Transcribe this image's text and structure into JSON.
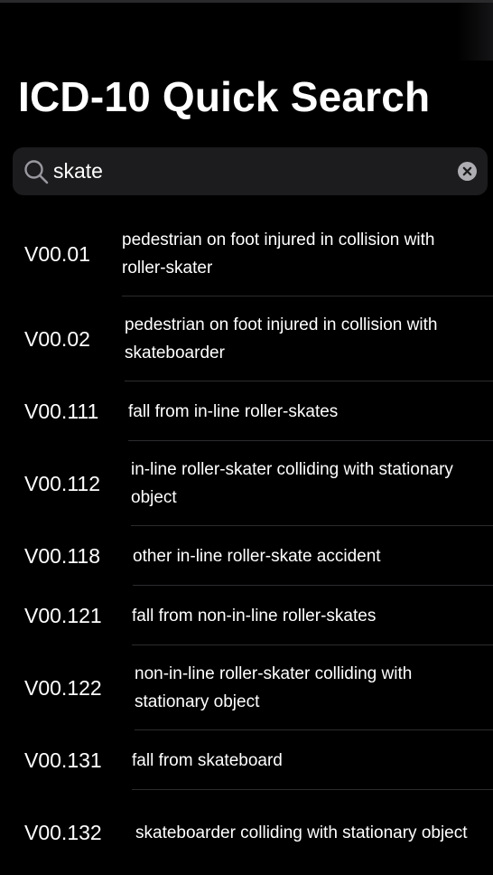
{
  "page": {
    "title": "ICD-10 Quick Search"
  },
  "search": {
    "value": "skate",
    "placeholder": "Search"
  },
  "results": [
    {
      "code": "V00.01",
      "description": "pedestrian on foot injured in collision with roller-skater"
    },
    {
      "code": "V00.02",
      "description": "pedestrian on foot injured in collision with skateboarder"
    },
    {
      "code": "V00.111",
      "description": "fall from in-line roller-skates"
    },
    {
      "code": "V00.112",
      "description": "in-line roller-skater colliding with stationary object"
    },
    {
      "code": "V00.118",
      "description": "other in-line roller-skate accident"
    },
    {
      "code": "V00.121",
      "description": "fall from non-in-line roller-skates"
    },
    {
      "code": "V00.122",
      "description": "non-in-line roller-skater colliding with stationary object"
    },
    {
      "code": "V00.131",
      "description": "fall from skateboard"
    },
    {
      "code": "V00.132",
      "description": "skateboarder colliding with stationary object"
    }
  ]
}
